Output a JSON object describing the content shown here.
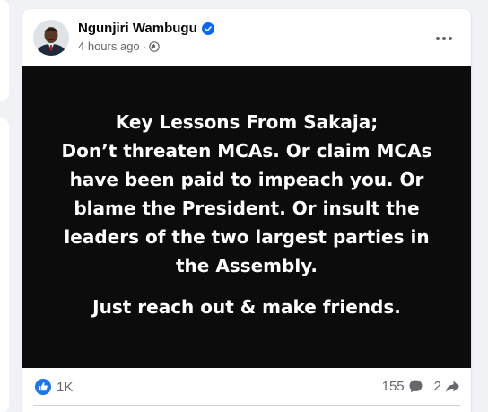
{
  "post": {
    "author": {
      "name": "Ngunjiri Wambugu",
      "verified_icon": "verified-badge-icon"
    },
    "timestamp": "4 hours ago",
    "separator": "·",
    "audience_icon": "globe-icon",
    "more_icon": "more-options-icon",
    "body": {
      "lines": [
        "Key Lessons From Sakaja;",
        "Don’t threaten MCAs. Or claim MCAs have been paid to impeach you. Or blame the President. Or insult the leaders of the two largest parties in the Assembly."
      ],
      "closing": "Just reach out & make friends."
    },
    "stats": {
      "reactions": "1K",
      "comments": "155",
      "shares": "2"
    }
  },
  "colors": {
    "page_bg": "#f0f2f5",
    "card_bg": "#ffffff",
    "post_bg": "#0c0c0c",
    "secondary_text": "#65676b",
    "brand_blue": "#0866ff"
  }
}
